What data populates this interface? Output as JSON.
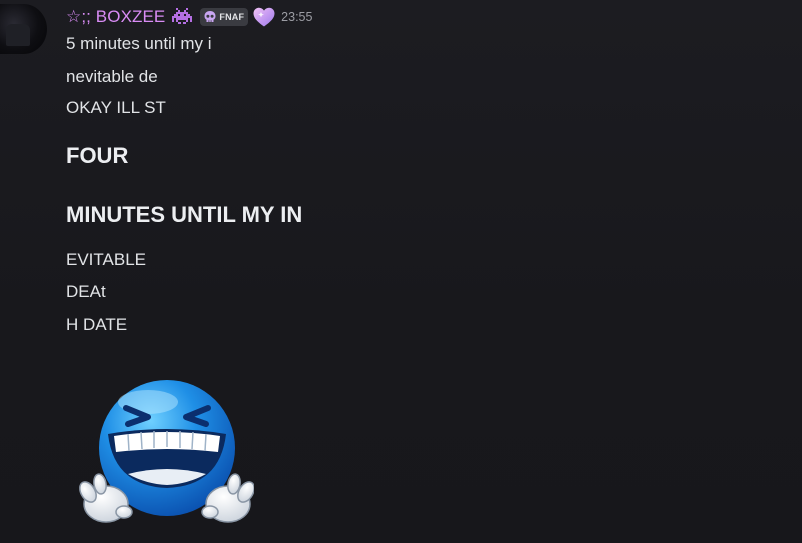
{
  "message": {
    "author": "☆;; BOXZEE",
    "author_emoji_icon": "alien-monster-icon",
    "tag": {
      "icon": "skull-icon",
      "label": "FNAF"
    },
    "decoration_icon": "heart-icon",
    "timestamp": "23:55",
    "lines": [
      "5 minutes until my i",
      "nevitable de",
      "OKAY ILL ST"
    ],
    "headings": [
      "FOUR",
      "MINUTES UNTIL MY IN"
    ],
    "tail_lines": [
      "EVITABLE",
      "DEAt",
      "H DATE"
    ],
    "emoji": "laughing-blue-face-emoji"
  },
  "colors": {
    "background": "#1b1b20",
    "username": "#d98cf5",
    "text": "#e1e3e6",
    "timestamp": "#9c9da4",
    "tag_bg": "#3a3b41"
  }
}
